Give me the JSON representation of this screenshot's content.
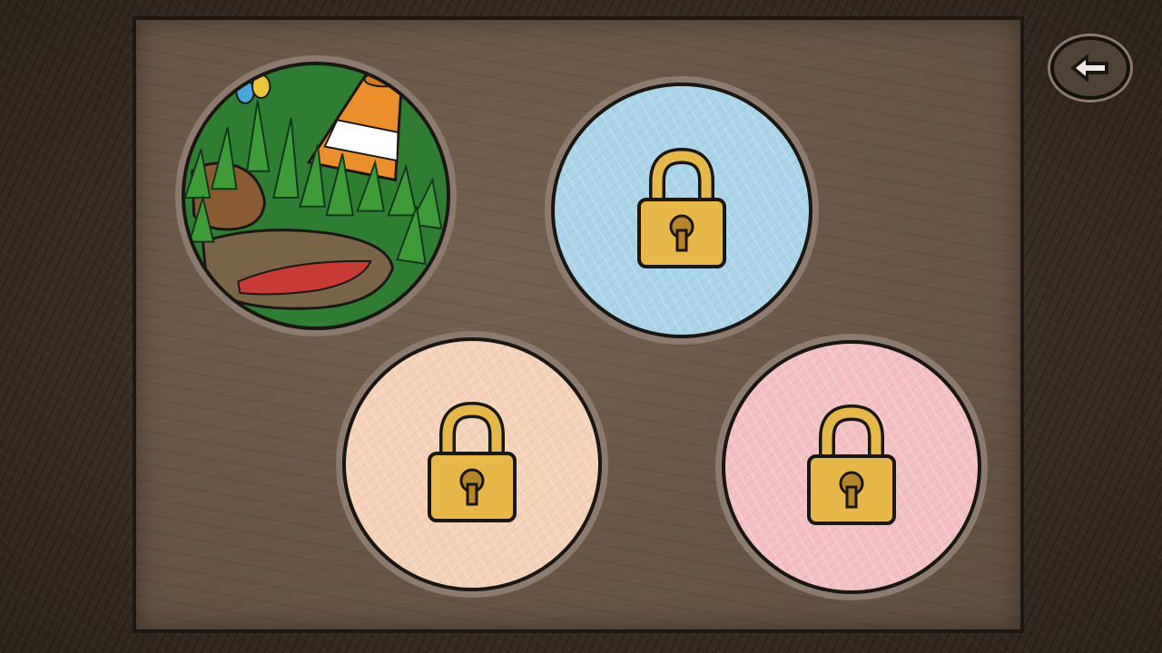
{
  "colors": {
    "board": "#6b5849",
    "frame_outline": "#1a1612",
    "circle_ring": "#8b7a6d",
    "lock_gold": "#e6b84a"
  },
  "back_button": {
    "icon": "back-arrow-icon"
  },
  "levels": [
    {
      "id": 1,
      "state": "unlocked",
      "theme": "grass-traffic-cone",
      "color": "#2f7d32"
    },
    {
      "id": 2,
      "state": "locked",
      "icon": "padlock-icon",
      "color": "#a9d4ea"
    },
    {
      "id": 3,
      "state": "locked",
      "icon": "padlock-icon",
      "color": "#f6d2b9"
    },
    {
      "id": 4,
      "state": "locked",
      "icon": "padlock-icon",
      "color": "#f3c0c4"
    }
  ]
}
